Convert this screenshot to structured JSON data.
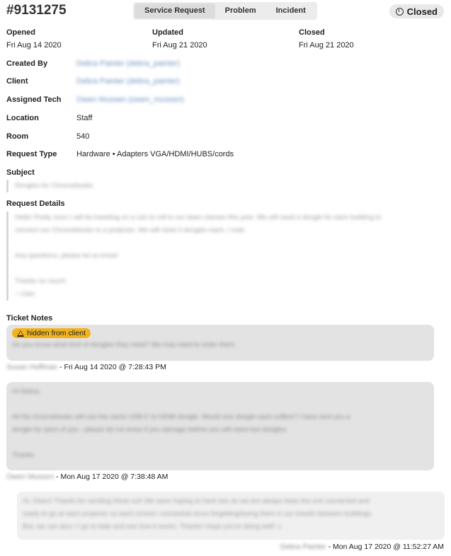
{
  "ticket": {
    "id": "#9131275"
  },
  "type_tabs": [
    {
      "label": "Service Request",
      "active": true
    },
    {
      "label": "Problem",
      "active": false
    },
    {
      "label": "Incident",
      "active": false
    }
  ],
  "status": {
    "label": "Closed"
  },
  "dates": {
    "opened_label": "Opened",
    "opened": "Fri Aug 14 2020",
    "updated_label": "Updated",
    "updated": "Fri Aug 21 2020",
    "closed_label": "Closed",
    "closed": "Fri Aug 21 2020"
  },
  "fields": {
    "created_by_label": "Created By",
    "created_by": "Debra Painter (debra_painter)",
    "client_label": "Client",
    "client": "Debra Painter (debra_painter)",
    "assigned_label": "Assigned Tech",
    "assigned": "Owen Mussen (owen_mussen)",
    "location_label": "Location",
    "location": "Staff",
    "room_label": "Room",
    "room": "540",
    "request_type_label": "Request Type",
    "request_type": "Hardware • Adapters VGA/HDMI/HUBS/cords"
  },
  "subject": {
    "label": "Subject",
    "text": "Dongles for Chromebooks"
  },
  "details": {
    "label": "Request Details",
    "lines": [
      "Hello! Pretty soon I will be traveling on a cart to roll to our team classes this year. We will need a dongle for each building to",
      "connect our Chromebooks to a projector. We will need 3 dongles each, I note.",
      "Any questions, please let us know!",
      "Thanks so much!",
      "~ Lilas"
    ]
  },
  "notes": {
    "label": "Ticket Notes",
    "hidden_tag": "hidden from client",
    "items": [
      {
        "lines": [
          "Do you know what kind of dongles they need? We may need to order them."
        ],
        "author": "Susan Hoffman",
        "stamp": "- Fri Aug 14 2020 @ 7:28:43 PM"
      },
      {
        "lines": [
          "Hi Debra,",
          "All the chromebooks will use the same USB-C to HDMI dongle. Would one dongle each suffice? I have sent you a",
          "dongle for each of you - please let me know if you damage before you will need two dongles.",
          "Thanks"
        ],
        "author": "Owen Mussen",
        "stamp": "- Mon Aug 17 2020 @ 7:38:48 AM"
      },
      {
        "lines": [
          "Hi, Owen! Thanks for sending these out! We were hoping to have two as we are always keep the one connected and",
          "ready to go at each projector so each school / somewhat since forgetting/losing them in our travels between buildings.",
          "But, we can also / I go to date and see how it works. Thanks! Hope you're doing well! :)"
        ],
        "author": "Debra Painter",
        "stamp": "- Mon Aug 17 2020 @ 11:52:27 AM"
      }
    ]
  },
  "colors": {
    "hidden_tag": "#f2b21b",
    "note_bg": "#e3e3e3",
    "reply_bg": "#f0f0f0"
  }
}
